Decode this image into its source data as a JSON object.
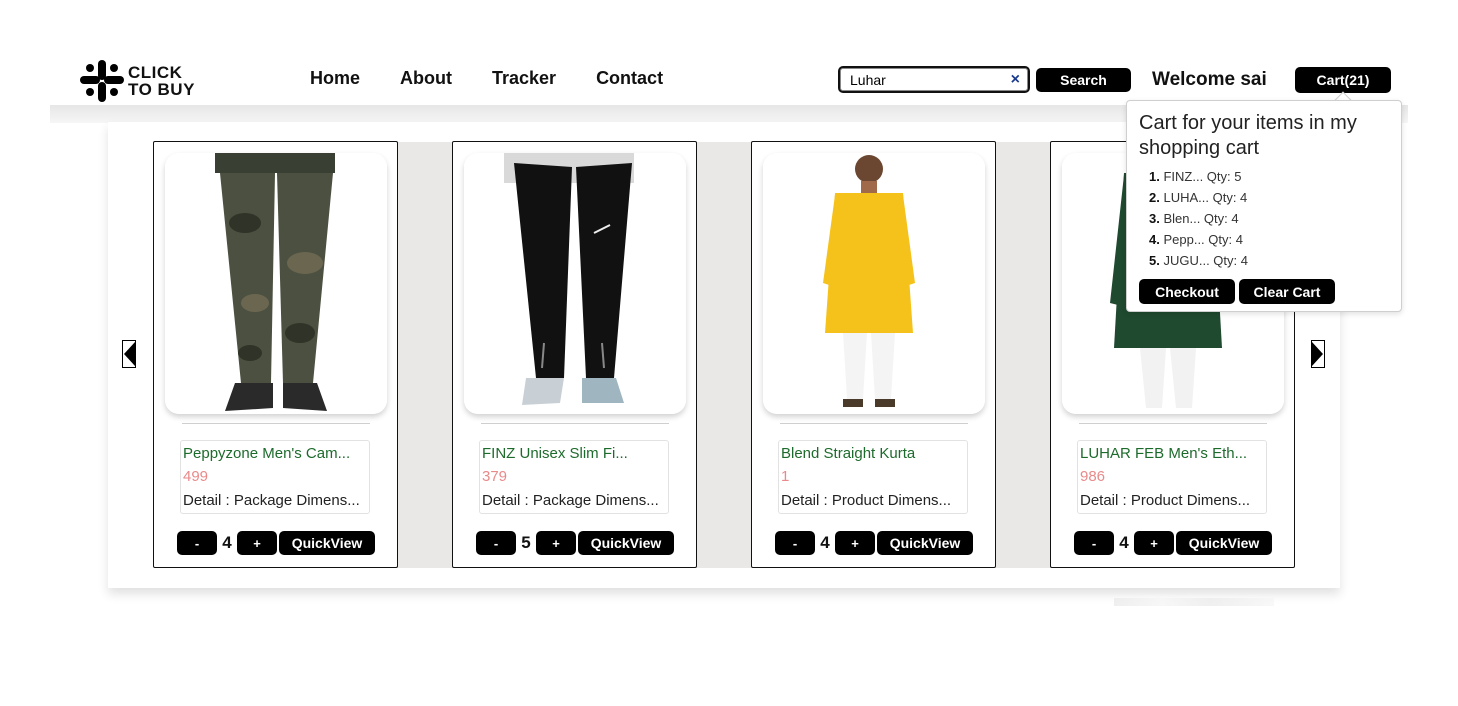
{
  "brand": {
    "line1": "CLICK",
    "line2": "TO BUY"
  },
  "nav": {
    "items": [
      "Home",
      "About",
      "Tracker",
      "Contact"
    ]
  },
  "search": {
    "value": "Luhar",
    "clear_icon": "×",
    "button_label": "Search"
  },
  "user": {
    "welcome": "Welcome sai"
  },
  "cart": {
    "button_label": "Cart(21)"
  },
  "popover": {
    "title": "Cart for your items in my shopping cart",
    "items": [
      {
        "num": "1.",
        "text": "FINZ... Qty: 5"
      },
      {
        "num": "2.",
        "text": "LUHA... Qty: 4"
      },
      {
        "num": "3.",
        "text": "Blen... Qty: 4"
      },
      {
        "num": "4.",
        "text": "Pepp... Qty: 4"
      },
      {
        "num": "5.",
        "text": "JUGU... Qty: 4"
      }
    ],
    "checkout_label": "Checkout",
    "clear_label": "Clear Cart"
  },
  "products": [
    {
      "name": "Peppyzone Men's Cam...",
      "price": "499",
      "detail": "Detail : Package Dimens...",
      "qty": "4",
      "minus": "-",
      "plus": "+",
      "quickview": "QuickView",
      "image": "camo-jogger-pants"
    },
    {
      "name": "FINZ Unisex Slim Fi...",
      "price": "379",
      "detail": "Detail : Package Dimens...",
      "qty": "5",
      "minus": "-",
      "plus": "+",
      "quickview": "QuickView",
      "image": "black-track-pants"
    },
    {
      "name": "Blend Straight Kurta",
      "price": "1",
      "detail": "Detail : Product Dimens...",
      "qty": "4",
      "minus": "-",
      "plus": "+",
      "quickview": "QuickView",
      "image": "yellow-kurta"
    },
    {
      "name": "LUHAR FEB Men's Eth...",
      "price": "986",
      "detail": "Detail : Product Dimens...",
      "qty": "4",
      "minus": "-",
      "plus": "+",
      "quickview": "QuickView",
      "image": "green-ethnic-kurta"
    }
  ],
  "colors": {
    "accent": "#000000",
    "product_name": "#1d6b2c",
    "price": "#e98a8a",
    "track_bg": "#e9e8e6"
  }
}
